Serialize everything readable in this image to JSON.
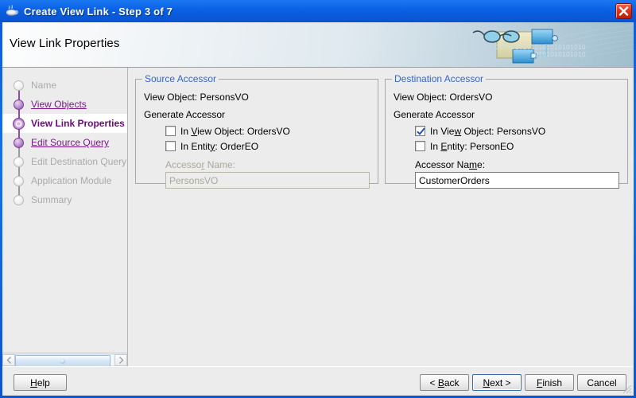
{
  "window": {
    "title": "Create View Link - Step 3 of 7",
    "title_icon": "coffee-cup-icon",
    "close_icon": "close-icon"
  },
  "header": {
    "title": "View Link Properties",
    "binary_art_line1": "01010101010101010101010",
    "binary_art_line2": "0101010101010"
  },
  "sidebar": {
    "steps": [
      {
        "label": "Name",
        "state": "todo"
      },
      {
        "label": "View Objects",
        "state": "done"
      },
      {
        "label": "View Link Properties",
        "state": "current"
      },
      {
        "label": "Edit Source Query",
        "state": "done"
      },
      {
        "label": "Edit Destination Query",
        "state": "todo"
      },
      {
        "label": "Application Module",
        "state": "todo"
      },
      {
        "label": "Summary",
        "state": "todo"
      }
    ],
    "scrollbar": {
      "left_arrow_icon": "chevron-left-icon",
      "right_arrow_icon": "chevron-right-icon"
    }
  },
  "source_accessor": {
    "group_title": "Source Accessor",
    "view_object_line": "View Object: PersonsVO",
    "generate_accessor_label": "Generate Accessor",
    "checkbox_view_object": {
      "prefix": "In ",
      "mnemonic": "V",
      "suffix": "iew Object: OrdersVO",
      "checked": false
    },
    "checkbox_entity": {
      "prefix": "In Entit",
      "mnemonic": "y",
      "suffix": ": OrderEO",
      "checked": false
    },
    "accessor_name_label_pre": "Accesso",
    "accessor_name_label_mn": "r",
    "accessor_name_label_post": " Name:",
    "accessor_name_value": "PersonsVO",
    "accessor_name_placeholder": "",
    "enabled": false
  },
  "destination_accessor": {
    "group_title": "Destination Accessor",
    "view_object_line": "View Object: OrdersVO",
    "generate_accessor_label": "Generate Accessor",
    "checkbox_view_object": {
      "prefix": "In Vie",
      "mnemonic": "w",
      "suffix": " Object: PersonsVO",
      "checked": true
    },
    "checkbox_entity": {
      "prefix": "In ",
      "mnemonic": "E",
      "suffix": "ntity: PersonEO",
      "checked": false
    },
    "accessor_name_label_pre": "Accessor Na",
    "accessor_name_label_mn": "m",
    "accessor_name_label_post": "e:",
    "accessor_name_value": "CustomerOrders",
    "accessor_name_placeholder": "",
    "enabled": true
  },
  "footer": {
    "help": {
      "pre": "",
      "mn": "H",
      "post": "elp"
    },
    "back": {
      "pre": "< ",
      "mn": "B",
      "post": "ack"
    },
    "next": {
      "pre": "",
      "mn": "N",
      "post": "ext >",
      "focused": true
    },
    "finish": {
      "pre": "",
      "mn": "F",
      "post": "inish"
    },
    "cancel": {
      "pre": "",
      "mn": "",
      "post": "Cancel"
    }
  },
  "colors": {
    "titlebar_blue": "#0a60e4",
    "window_border_blue": "#0a4fd0",
    "close_red": "#e2341c",
    "group_title_blue": "#3366cc",
    "step_link_purple": "#7a1a8a",
    "step_current_purple": "#6b0a7a",
    "bullet_purple": "#8e4bab",
    "panel_grey": "#ececec",
    "disabled_text": "#a9a899",
    "checkmark_blue": "#2255bb"
  }
}
